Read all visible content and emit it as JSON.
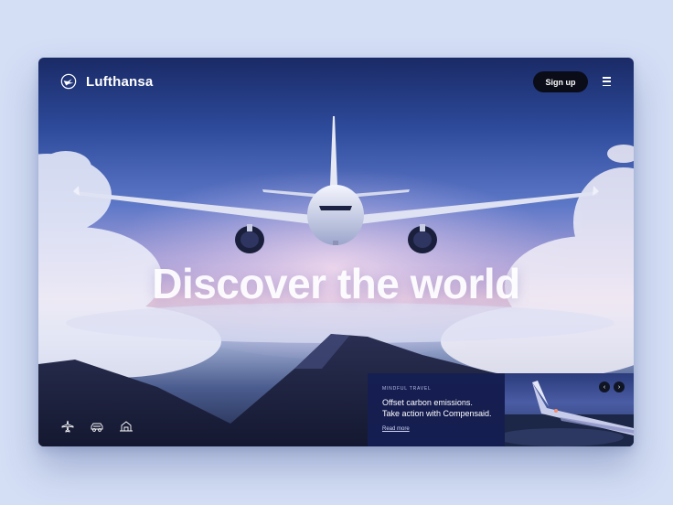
{
  "brand": {
    "name": "Lufthansa"
  },
  "header": {
    "signup_label": "Sign up"
  },
  "hero": {
    "headline": "Discover the world"
  },
  "promo": {
    "eyebrow": "MINDFUL TRAVEL",
    "title_line1": "Offset carbon emissions.",
    "title_line2": "Take action with Compensaid.",
    "link": "Read more"
  },
  "icons": {
    "logo": "lufthansa-crane-icon",
    "menu": "hamburger-menu-icon",
    "categories": [
      "plane-icon",
      "car-icon",
      "hotel-icon"
    ],
    "carousel_prev": "chevron-left-icon",
    "carousel_next": "chevron-right-icon"
  },
  "colors": {
    "page_background": "#d4def5",
    "signup_button": "#0a0c18",
    "promo_panel": "#161e52"
  }
}
